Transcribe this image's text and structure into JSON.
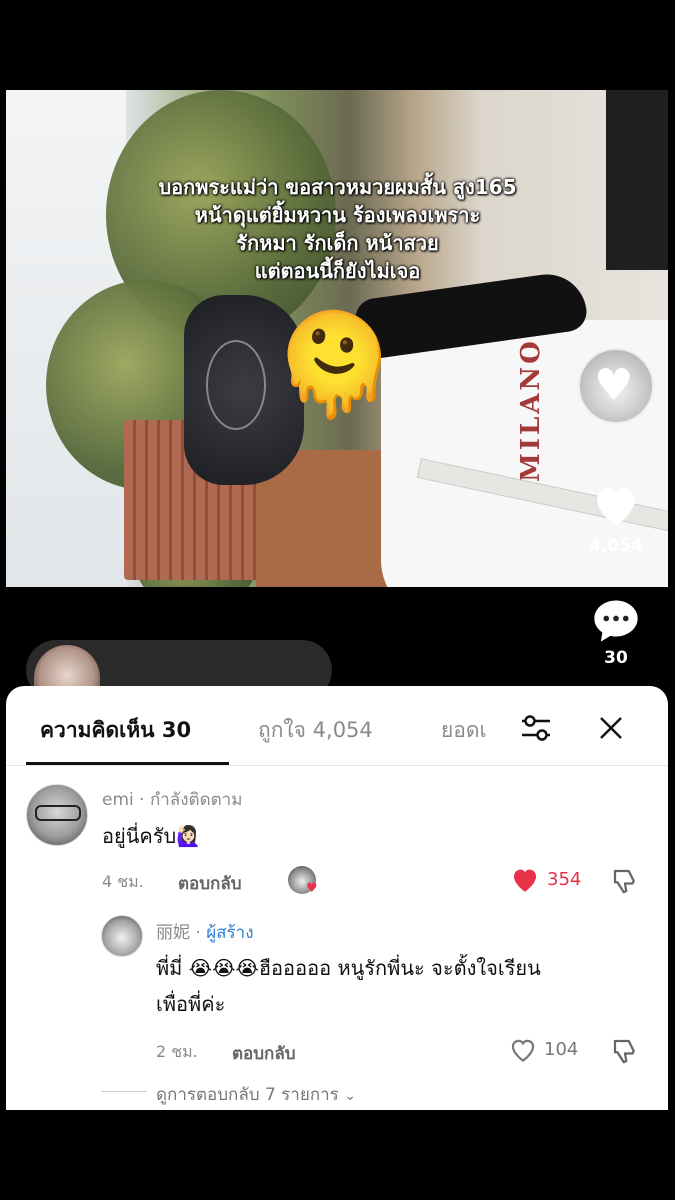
{
  "video": {
    "caption_lines": [
      "บอกพระแม่ว่า ขอสาวหมวยผมสั้น สูง165",
      "หน้าดุแต่ยิ้มหวาน ร้องเพลงเพราะ",
      "รักหมา รักเด็ก หน้าสวย",
      "แต่ตอนนี้ก็ยังไม่เจอ"
    ],
    "shirt_text": "MILANO",
    "face_emoji": "🫠"
  },
  "rail": {
    "likes_count": "4,054",
    "comments_count": "30",
    "heart_icon": "heart-icon",
    "comment_icon": "comment-bubble-icon"
  },
  "sheet": {
    "tabs": [
      {
        "label": "ความคิดเห็น 30",
        "active": true
      },
      {
        "label": "ถูกใจ 4,054",
        "active": false
      },
      {
        "label": "ยอดเ",
        "active": false
      }
    ],
    "comments": [
      {
        "author": "emi",
        "separator": "·",
        "relation": "กำลังติดตาม",
        "text": "อยู่นี่ครับ🙋🏻‍♀️",
        "time": "4 ชม.",
        "reply_label": "ตอบกลับ",
        "likes": "354",
        "liked": true
      },
      {
        "author": "丽妮",
        "separator": "·",
        "relation": "ผู้สร้าง",
        "text_line1": "พี่มี่ 😭😭😭ฮือออออ หนูรักพี่นะ จะตั้งใจเรียน",
        "text_line2": "เพื่อพี่ค่ะ",
        "time": "2 ชม.",
        "reply_label": "ตอบกลับ",
        "likes": "104",
        "liked": false
      }
    ],
    "view_replies": "ดูการตอบกลับ 7 รายการ",
    "accent_red": "#e8324a",
    "creator_blue": "#2f7fd6"
  }
}
